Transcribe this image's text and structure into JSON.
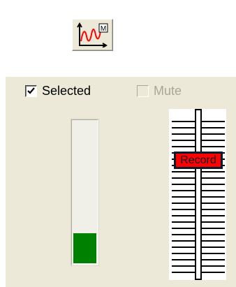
{
  "toolbar": {
    "graph_button_icon": "line-graph-icon",
    "graph_button_badge": "M"
  },
  "channel": {
    "selected_label": "Selected",
    "selected_checked": true,
    "mute_label": "Mute",
    "mute_checked": false,
    "mute_enabled": false,
    "meter_level_fraction": 0.21,
    "fader_label": "Record",
    "fader_position_fraction": 0.3
  },
  "colors": {
    "panel_bg": "#ece9d8",
    "meter_fill": "#008000",
    "fader_label_bg": "#ff0000",
    "fader_thumb": "#0b1a2c",
    "graph_curve": "#ff0000"
  }
}
